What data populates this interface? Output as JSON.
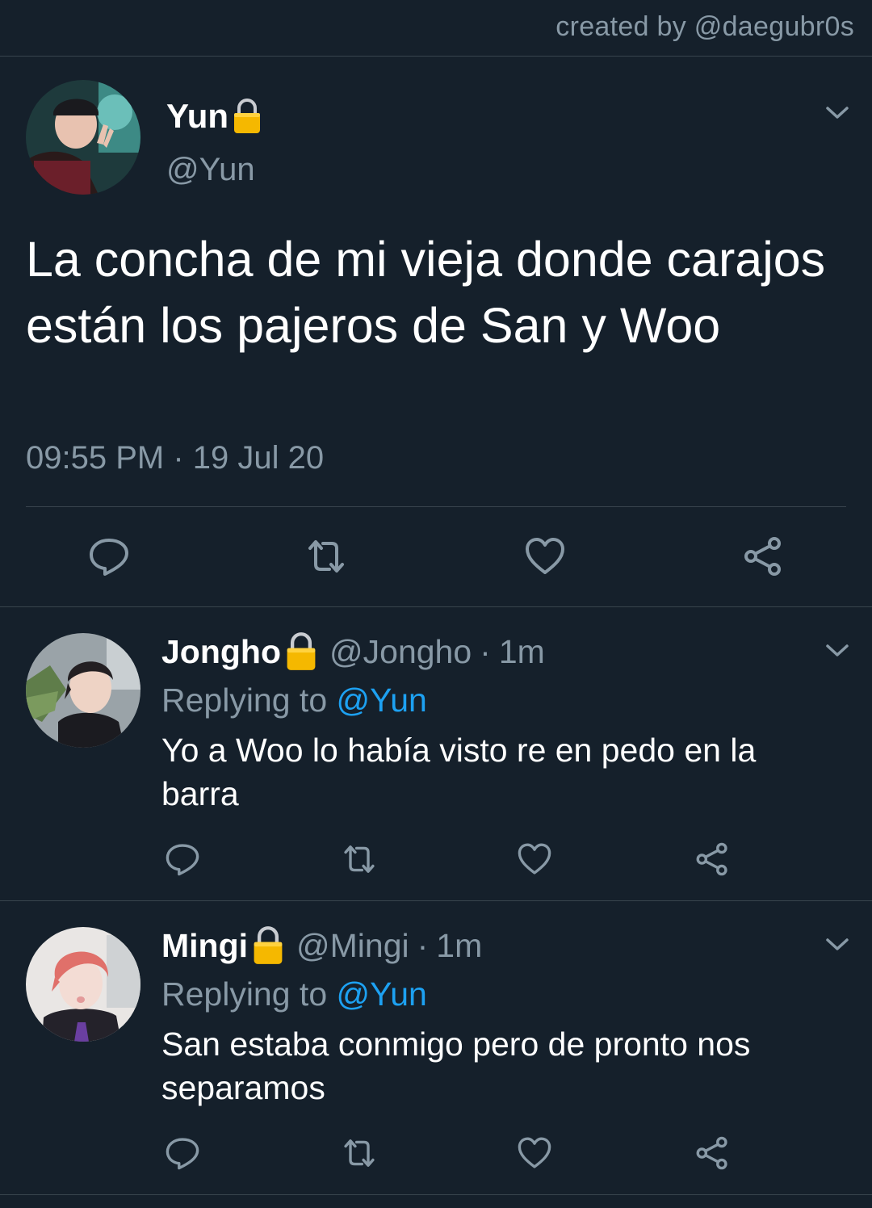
{
  "credit": "created by @daegubr0s",
  "main_tweet": {
    "name": "Yun",
    "handle": "@Yun",
    "text": "La concha de mi vieja donde carajos están los pajeros de San y Woo",
    "time": "09:55 PM",
    "separator": "·",
    "date": "19 Jul 20",
    "icons": [
      "reply-icon",
      "retweet-icon",
      "like-icon",
      "share-icon"
    ]
  },
  "replies": [
    {
      "name": "Jongho",
      "handle": "@Jongho",
      "separator": "·",
      "age": "1m",
      "replying_label": "Replying to",
      "replying_to": "@Yun",
      "text": "Yo a Woo lo había visto re en pedo en la barra"
    },
    {
      "name": "Mingi",
      "handle": "@Mingi",
      "separator": "·",
      "age": "1m",
      "replying_label": "Replying to",
      "replying_to": "@Yun",
      "text": "San estaba conmigo pero de pronto nos separamos"
    }
  ],
  "colors": {
    "background": "#15202b",
    "secondary_text": "#8899a6",
    "divider": "#38444d",
    "accent": "#1da1f2",
    "lock": "#f5b800"
  }
}
